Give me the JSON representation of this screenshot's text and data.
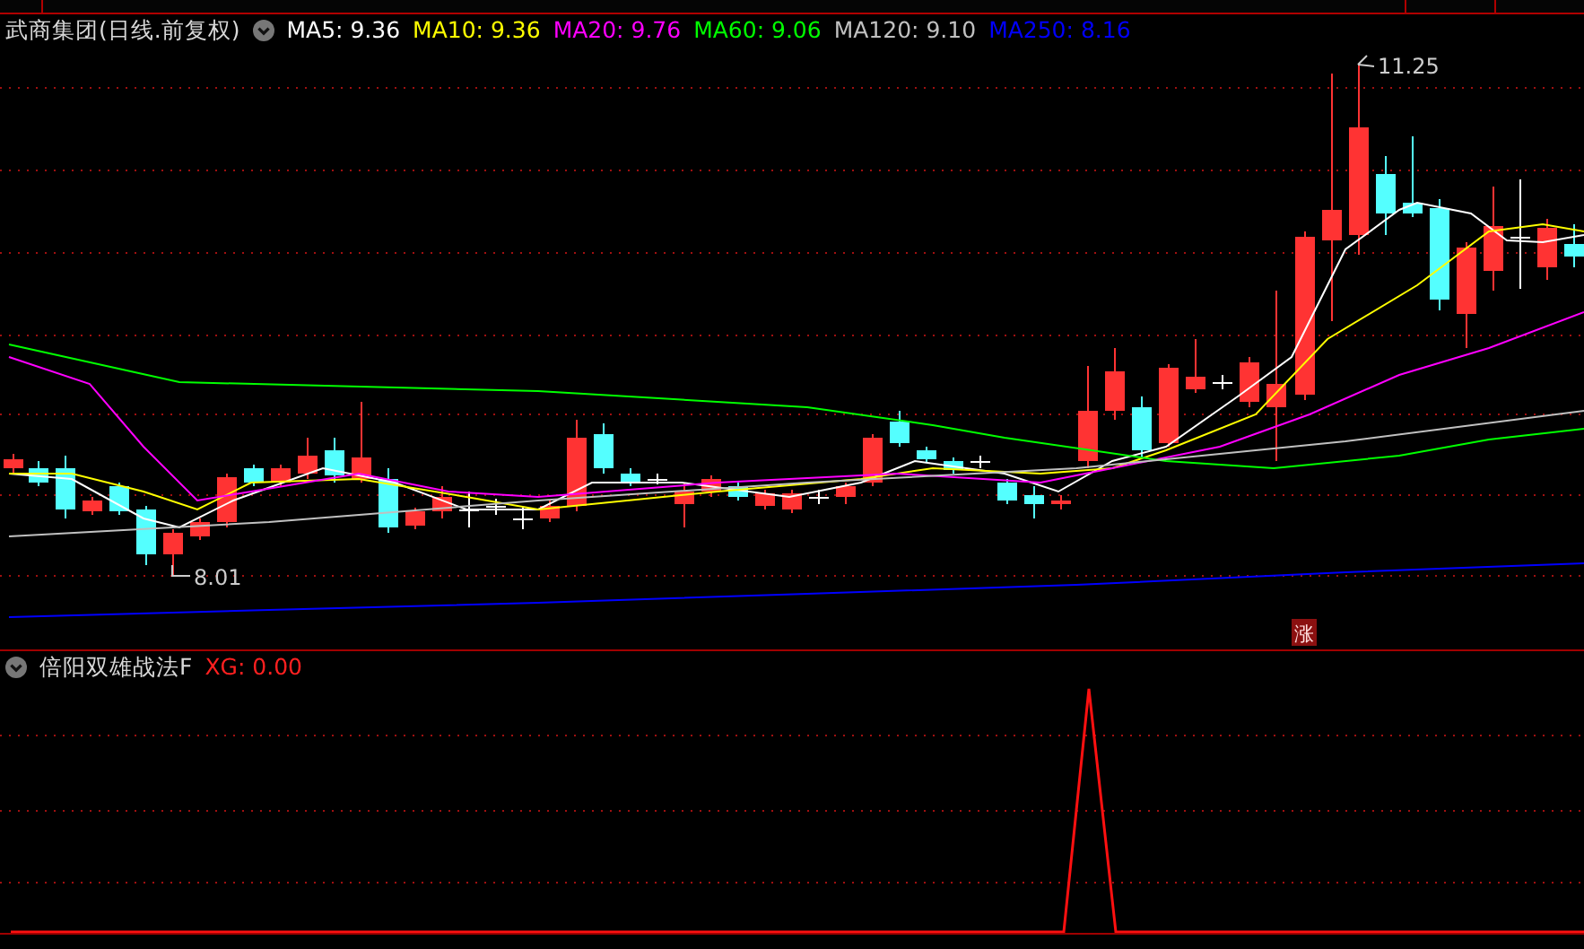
{
  "legend": {
    "title": "武商集团(日线.前复权)",
    "indicators": [
      {
        "label": "MA5: 9.36",
        "color": "#ffffff"
      },
      {
        "label": "MA10: 9.36",
        "color": "#ffff00"
      },
      {
        "label": "MA20: 9.76",
        "color": "#ff00ff"
      },
      {
        "label": "MA60: 9.06",
        "color": "#00ff00"
      },
      {
        "label": "MA120: 9.10",
        "color": "#c0c0c0"
      },
      {
        "label": "MA250: 8.16",
        "color": "#0000ff"
      }
    ]
  },
  "price_chart": {
    "high_label": "11.25",
    "low_label": "8.01",
    "badge": "涨"
  },
  "indicator_panel": {
    "title": "倍阳双雄战法F",
    "reading": "XG: 0.00"
  }
}
